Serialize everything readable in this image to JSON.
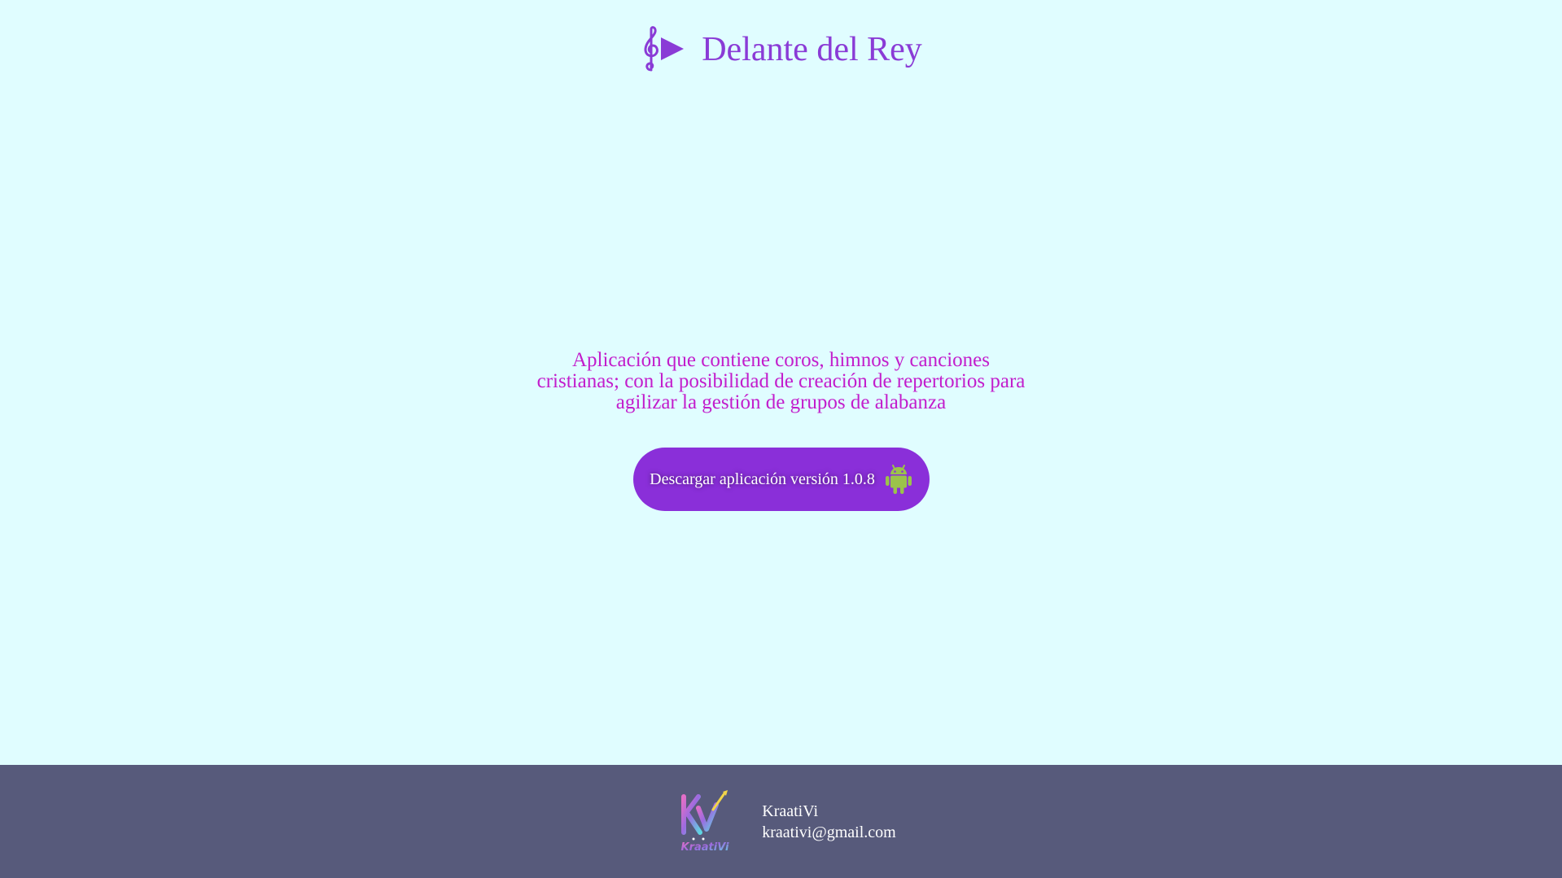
{
  "header": {
    "title": "Delante del Rey",
    "logo_icon": "treble-clef-play-icon",
    "title_color": "#8a3bd6"
  },
  "main": {
    "description": "Aplicación que contiene coros, himnos y canciones cristianas; con la posibilidad de creación de repertorios para agilizar la gestión de grupos de alabanza",
    "description_color": "#c21dcc",
    "download_button": {
      "label": "Descargar aplicación versión 1.0.8",
      "icon": "android-icon",
      "background": "#8a2fd9"
    }
  },
  "footer": {
    "background": "#575a7b",
    "logo_icon": "kraativi-logo-icon",
    "logo_text": "KraatiVi",
    "name": "KraatiVi",
    "email": "kraativi@gmail.com"
  },
  "colors": {
    "page_background": "#e0fdff",
    "android_green": "#9bc34a"
  }
}
